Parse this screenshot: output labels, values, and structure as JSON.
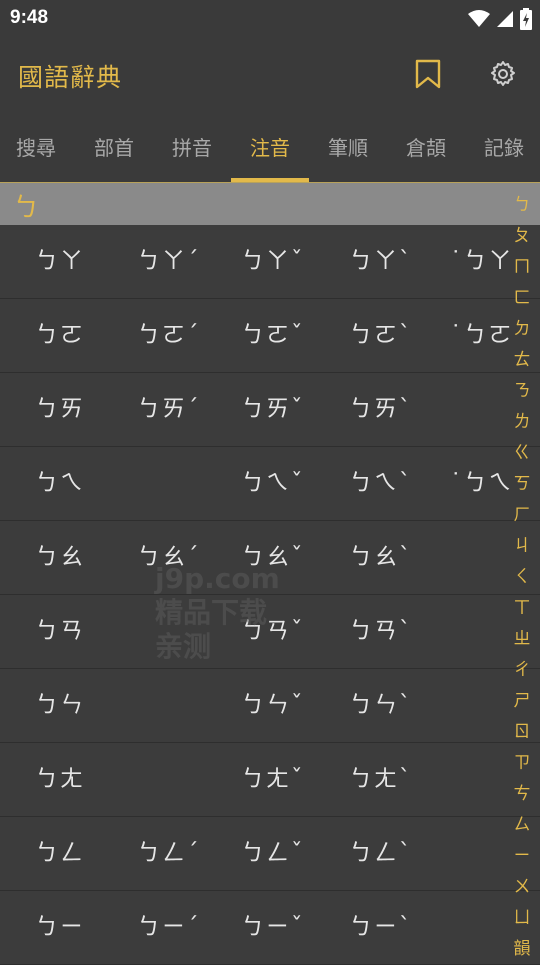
{
  "status": {
    "time": "9:48"
  },
  "appbar": {
    "title": "國語辭典"
  },
  "tabs": [
    {
      "label": "搜尋"
    },
    {
      "label": "部首"
    },
    {
      "label": "拼音"
    },
    {
      "label": "注音"
    },
    {
      "label": "筆順"
    },
    {
      "label": "倉頡"
    },
    {
      "label": "記錄"
    }
  ],
  "section": {
    "header": "ㄅ"
  },
  "rows": [
    [
      "ㄅㄚ",
      "ㄅㄚˊ",
      "ㄅㄚˇ",
      "ㄅㄚˋ",
      "˙ㄅㄚ"
    ],
    [
      "ㄅㄛ",
      "ㄅㄛˊ",
      "ㄅㄛˇ",
      "ㄅㄛˋ",
      "˙ㄅㄛ"
    ],
    [
      "ㄅㄞ",
      "ㄅㄞˊ",
      "ㄅㄞˇ",
      "ㄅㄞˋ",
      ""
    ],
    [
      "ㄅㄟ",
      "",
      "ㄅㄟˇ",
      "ㄅㄟˋ",
      "˙ㄅㄟ"
    ],
    [
      "ㄅㄠ",
      "ㄅㄠˊ",
      "ㄅㄠˇ",
      "ㄅㄠˋ",
      ""
    ],
    [
      "ㄅㄢ",
      "",
      "ㄅㄢˇ",
      "ㄅㄢˋ",
      ""
    ],
    [
      "ㄅㄣ",
      "",
      "ㄅㄣˇ",
      "ㄅㄣˋ",
      ""
    ],
    [
      "ㄅㄤ",
      "",
      "ㄅㄤˇ",
      "ㄅㄤˋ",
      ""
    ],
    [
      "ㄅㄥ",
      "ㄅㄥˊ",
      "ㄅㄥˇ",
      "ㄅㄥˋ",
      ""
    ],
    [
      "ㄅㄧ",
      "ㄅㄧˊ",
      "ㄅㄧˇ",
      "ㄅㄧˋ",
      ""
    ]
  ],
  "index": [
    "ㄅ",
    "ㄆ",
    "ㄇ",
    "ㄈ",
    "ㄉ",
    "ㄊ",
    "ㄋ",
    "ㄌ",
    "ㄍ",
    "ㄎ",
    "ㄏ",
    "ㄐ",
    "ㄑ",
    "ㄒ",
    "ㄓ",
    "ㄔ",
    "ㄕ",
    "ㄖ",
    "ㄗ",
    "ㄘ",
    "ㄙ",
    "ㄧ",
    "ㄨ",
    "ㄩ",
    "韻"
  ],
  "watermark": {
    "line1": "j9p.com",
    "line2": "精品下载",
    "line3": "亲测"
  },
  "colors": {
    "accent": "#e2b94a",
    "background": "#3c3c3c",
    "header_bar": "#8a8a8a"
  },
  "icons": {
    "bookmark": "bookmark-icon",
    "settings": "gear-icon"
  }
}
